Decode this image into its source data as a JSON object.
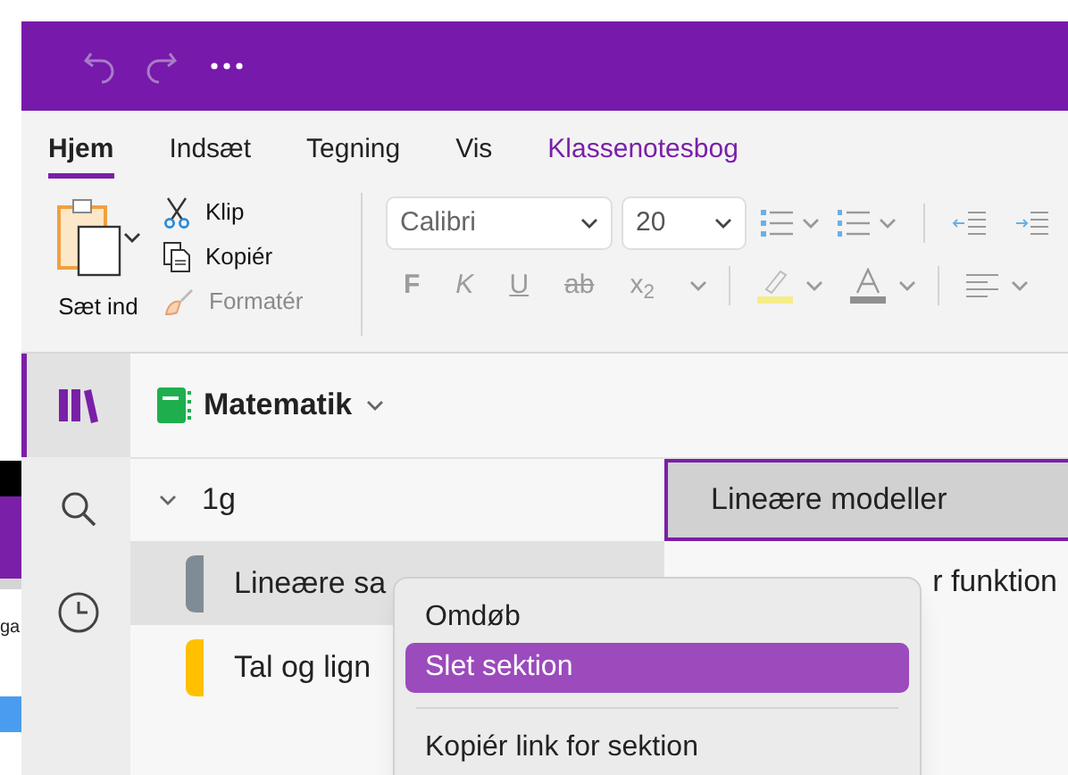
{
  "background_window": {
    "text": "ga"
  },
  "tabs": [
    {
      "label": "Hjem",
      "selected": true,
      "color": "#222222"
    },
    {
      "label": "Indsæt",
      "selected": false,
      "color": "#222222"
    },
    {
      "label": "Tegning",
      "selected": false,
      "color": "#222222"
    },
    {
      "label": "Vis",
      "selected": false,
      "color": "#222222"
    },
    {
      "label": "Klassenotesbog",
      "selected": false,
      "color": "#7a1fa8"
    }
  ],
  "clipboard": {
    "paste": "Sæt ind",
    "actions": [
      {
        "label": "Klip",
        "disabled": false
      },
      {
        "label": "Kopiér",
        "disabled": false
      },
      {
        "label": "Formatér",
        "disabled": true
      }
    ]
  },
  "font": {
    "name": "Calibri",
    "size": "20"
  },
  "format_buttons": [
    {
      "label": "F",
      "disabled": true
    },
    {
      "label": "K",
      "disabled": true
    },
    {
      "label": "U",
      "disabled": true
    },
    {
      "label": "ab",
      "disabled": true
    },
    {
      "label": "x$_{2}$",
      "disabled": true
    }
  ],
  "notebook": {
    "title": "Matematik"
  },
  "nav": [
    {
      "kind": "notebooks",
      "selected": true
    },
    {
      "kind": "search",
      "selected": false
    },
    {
      "kind": "recent",
      "selected": false
    }
  ],
  "section_group": {
    "label": "1g",
    "expanded": true
  },
  "sections": [
    {
      "label": "Lineære sa",
      "selected": true,
      "color": "#7f8c95"
    },
    {
      "label": "Tal og lign",
      "selected": false,
      "color": "#ffc000"
    }
  ],
  "pages": [
    {
      "label": "Lineære modeller",
      "selected": true
    },
    {
      "label": "r funktion",
      "selected": false
    }
  ],
  "context_menu": [
    {
      "label": "Omdøb",
      "selected": false,
      "separator_before": false
    },
    {
      "label": "Slet sektion",
      "selected": true,
      "separator_before": false
    },
    {
      "label": "Kopiér link for sektion",
      "selected": false,
      "separator_before": true
    }
  ]
}
